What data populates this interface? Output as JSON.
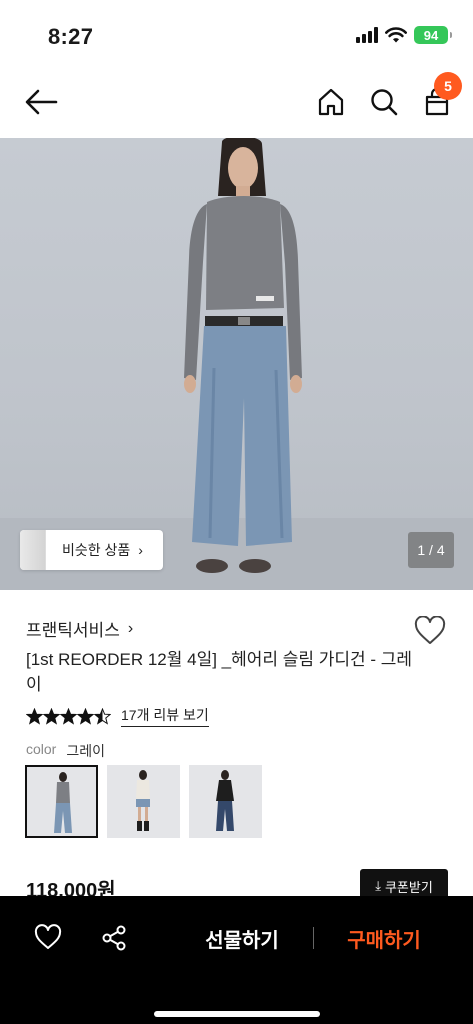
{
  "status_bar": {
    "time": "8:27",
    "battery": "94"
  },
  "nav": {
    "cart_count": "5"
  },
  "hero": {
    "similar_label": "비슷한 상품",
    "page_indicator": "1 / 4"
  },
  "product": {
    "brand": "프랜틱서비스",
    "title": "[1st REORDER 12월 4일] _헤어리 슬림 가디건 - 그레이",
    "rating": 4.5,
    "review_link": "17개 리뷰 보기",
    "color_label": "color",
    "color_value": "그레이",
    "price": "118,000원",
    "coupon_label": "쿠폰받기"
  },
  "bottom_bar": {
    "gift_label": "선물하기",
    "buy_label": "구매하기"
  },
  "colors": {
    "accent": "#ff5a1f",
    "bottom_bar": "#000000"
  }
}
